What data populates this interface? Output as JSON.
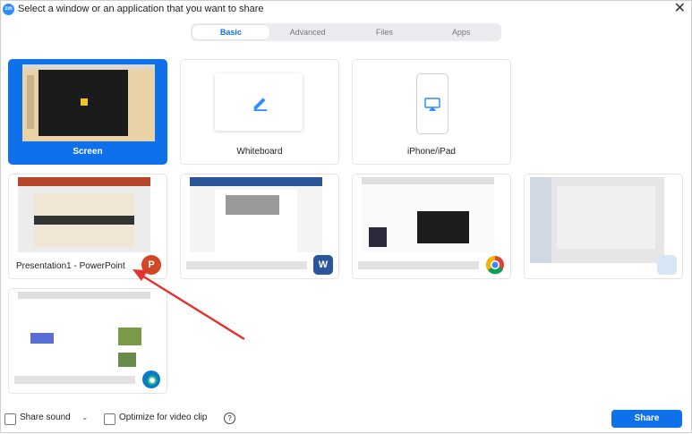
{
  "window": {
    "logo": "zm",
    "title": "Select a window or an application that you want to share",
    "close": "✕"
  },
  "tabs": [
    {
      "label": "Basic",
      "active": true
    },
    {
      "label": "Advanced",
      "active": false
    },
    {
      "label": "Files",
      "active": false
    },
    {
      "label": "Apps",
      "active": false
    }
  ],
  "tiles": {
    "screen": {
      "label": "Screen",
      "selected": true
    },
    "whiteboard": {
      "label": "Whiteboard"
    },
    "iphone": {
      "label": "iPhone/iPad"
    },
    "powerpoint": {
      "label": "Presentation1 - PowerPoint",
      "icon": "powerpoint-icon",
      "icon_text": "P",
      "color": "#D24726"
    },
    "word": {
      "icon": "word-icon",
      "icon_text": "W",
      "color": "#2B579A"
    },
    "chrome": {
      "icon": "chrome-icon"
    },
    "blurred": {
      "icon": "blurred-app-icon"
    },
    "edge": {
      "icon": "edge-icon",
      "color": "#0A7CC7"
    }
  },
  "footer": {
    "share_sound": "Share sound",
    "optimize": "Optimize for video clip",
    "help": "?",
    "share_button": "Share"
  },
  "colors": {
    "accent": "#0E71EB",
    "arrow": "#E5322D"
  }
}
